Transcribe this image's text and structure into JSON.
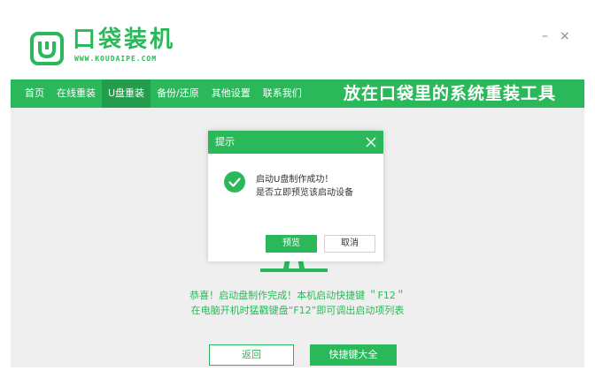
{
  "app": {
    "brand_name": "口袋装机",
    "brand_url": "WWW.KOUDAIPE.COM",
    "window_minimize": "–",
    "window_close": "×"
  },
  "nav": {
    "items": [
      {
        "label": "首页",
        "active": false
      },
      {
        "label": "在线重装",
        "active": false
      },
      {
        "label": "U盘重装",
        "active": true
      },
      {
        "label": "备份/还原",
        "active": false
      },
      {
        "label": "其他设置",
        "active": false
      },
      {
        "label": "联系我们",
        "active": false
      }
    ],
    "slogan": "放在口袋里的系统重装工具"
  },
  "dialog": {
    "title": "提示",
    "line1": "启动U盘制作成功！",
    "line2": "是否立即预览该启动设备",
    "preview_label": "预览",
    "cancel_label": "取消"
  },
  "main": {
    "message_line1": "恭喜！启动盘制作完成！本机启动快捷键 ＂F12＂",
    "message_line2": "在电脑开机时猛戳键盘“F12”即可调出启动项列表",
    "back_label": "返回",
    "hotkeys_label": "快捷键大全"
  },
  "colors": {
    "brand_green": "#2bb85a",
    "nav_active": "#239c4b",
    "background": "#efefef"
  }
}
